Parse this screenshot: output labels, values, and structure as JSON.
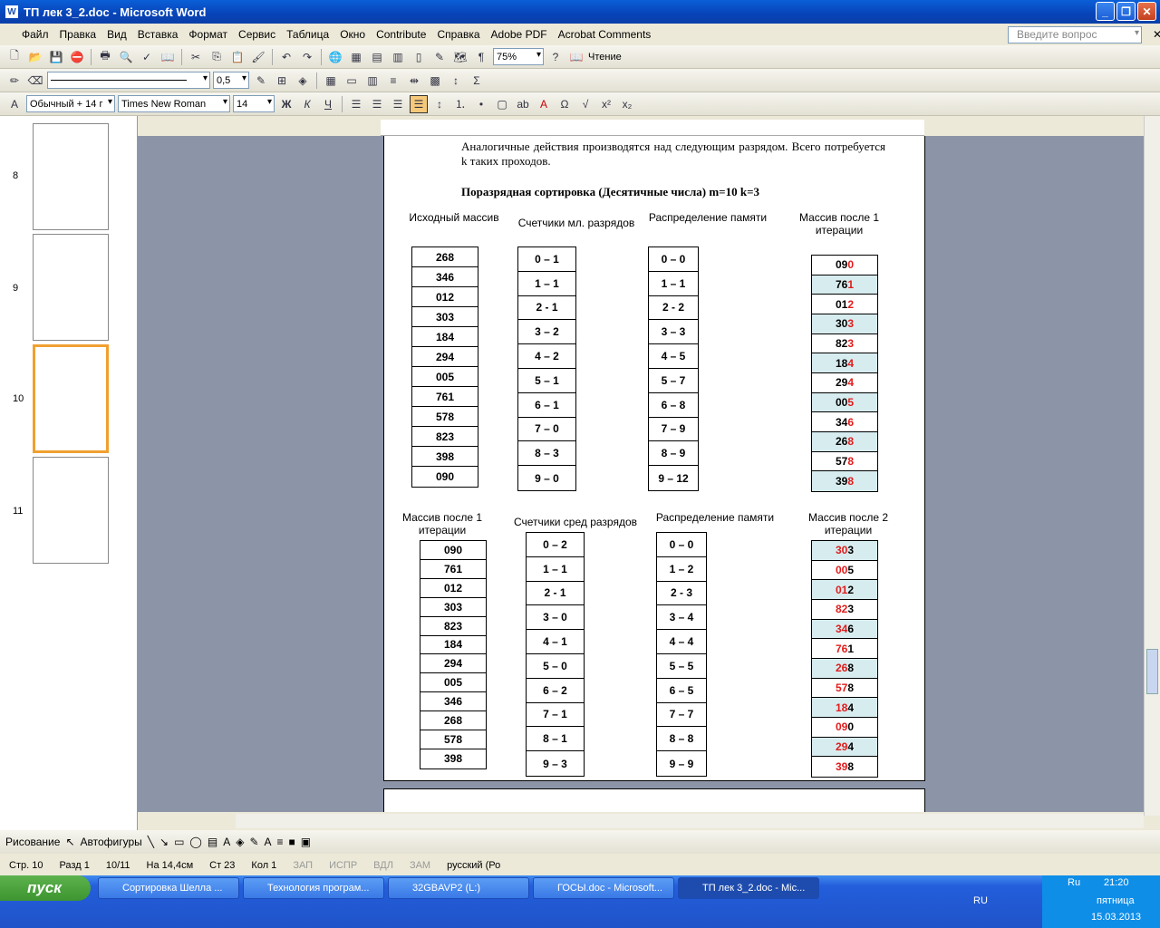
{
  "window": {
    "title": "ТП лек 3_2.doc - Microsoft Word"
  },
  "menu": [
    "Файл",
    "Правка",
    "Вид",
    "Вставка",
    "Формат",
    "Сервис",
    "Таблица",
    "Окно",
    "Contribute",
    "Справка",
    "Adobe PDF",
    "Acrobat Comments"
  ],
  "help_placeholder": "Введите вопрос",
  "toolbar": {
    "zoom": "75%",
    "read_label": "Чтение",
    "line_weight": "0,5",
    "style": "Обычный + 14 г",
    "font": "Times New Roman",
    "size": "14"
  },
  "thumbs": [
    "8",
    "9",
    "10",
    "11"
  ],
  "doc": {
    "para": "Аналогичные действия производятся над следующим разрядом. Всего потребуется k таких проходов.",
    "heading": "Поразрядная сортировка (Десятичные числа) m=10 k=3",
    "t1_head": [
      "Исходный массив",
      "Счетчики мл. разрядов",
      "Распределение памяти",
      "Массив после 1 итерации"
    ],
    "t2_head": [
      "Массив после 1 итерации",
      "Счетчики сред разрядов",
      "Распределение памяти",
      "Массив после 2 итерации"
    ],
    "src": [
      "268",
      "346",
      "012",
      "303",
      "184",
      "294",
      "005",
      "761",
      "578",
      "823",
      "398",
      "090"
    ],
    "cnt1": [
      "0 – 1",
      "1 – 1",
      "2 - 1",
      "3 – 2",
      "4 – 2",
      "5 – 1",
      "6 – 1",
      "7 – 0",
      "8 – 3",
      "9 – 0"
    ],
    "mem1": [
      "0 – 0",
      "1 – 1",
      "2 - 2",
      "3 – 3",
      "4 – 5",
      "5 – 7",
      "6 – 8",
      "7 – 9",
      "8 – 9",
      "9 – 12"
    ],
    "it1": [
      [
        "09",
        "0"
      ],
      [
        "76",
        "1"
      ],
      [
        "01",
        "2"
      ],
      [
        "30",
        "3"
      ],
      [
        "82",
        "3"
      ],
      [
        "18",
        "4"
      ],
      [
        "29",
        "4"
      ],
      [
        "00",
        "5"
      ],
      [
        "34",
        "6"
      ],
      [
        "26",
        "8"
      ],
      [
        "57",
        "8"
      ],
      [
        "39",
        "8"
      ]
    ],
    "it1b": [
      "090",
      "761",
      "012",
      "303",
      "823",
      "184",
      "294",
      "005",
      "346",
      "268",
      "578",
      "398"
    ],
    "cnt2": [
      "0 – 2",
      "1 – 1",
      "2 - 1",
      "3 – 0",
      "4 – 1",
      "5 – 0",
      "6 – 2",
      "7 – 1",
      "8 – 1",
      "9 – 3"
    ],
    "mem2": [
      "0 – 0",
      "1 – 2",
      "2 - 3",
      "3 – 4",
      "4 – 4",
      "5 – 5",
      "6 – 5",
      "7 – 7",
      "8 – 8",
      "9 – 9"
    ],
    "it2": [
      [
        "3",
        "0",
        "3"
      ],
      [
        "0",
        "0",
        "5"
      ],
      [
        "0",
        "1",
        "2"
      ],
      [
        "8",
        "2",
        "3"
      ],
      [
        "3",
        "4",
        "6"
      ],
      [
        "7",
        "6",
        "1"
      ],
      [
        "2",
        "6",
        "8"
      ],
      [
        "5",
        "7",
        "8"
      ],
      [
        "1",
        "8",
        "4"
      ],
      [
        "0",
        "9",
        "0"
      ],
      [
        "2",
        "9",
        "4"
      ],
      [
        "3",
        "9",
        "8"
      ]
    ]
  },
  "drawbar": {
    "draw": "Рисование",
    "autoshapes": "Автофигуры"
  },
  "status": {
    "page": "Стр. 10",
    "section": "Разд 1",
    "pages": "10/11",
    "at": "На 14,4см",
    "line": "Ст 23",
    "col": "Кол 1",
    "rec": "ЗАП",
    "trk": "ИСПР",
    "ext": "ВДЛ",
    "ovr": "ЗАМ",
    "lang": "русский (Ро"
  },
  "taskbar": {
    "start": "пуск",
    "tasks": [
      "Сортировка Шелла ...",
      "Технология програм...",
      "32GBAVP2 (L:)",
      "ГОСЫ.doc - Microsoft...",
      "ТП лек 3_2.doc - Mic..."
    ],
    "lang": "RU",
    "time": "21:20",
    "day": "пятница",
    "date": "15.03.2013",
    "tray_lang": "Ru"
  }
}
